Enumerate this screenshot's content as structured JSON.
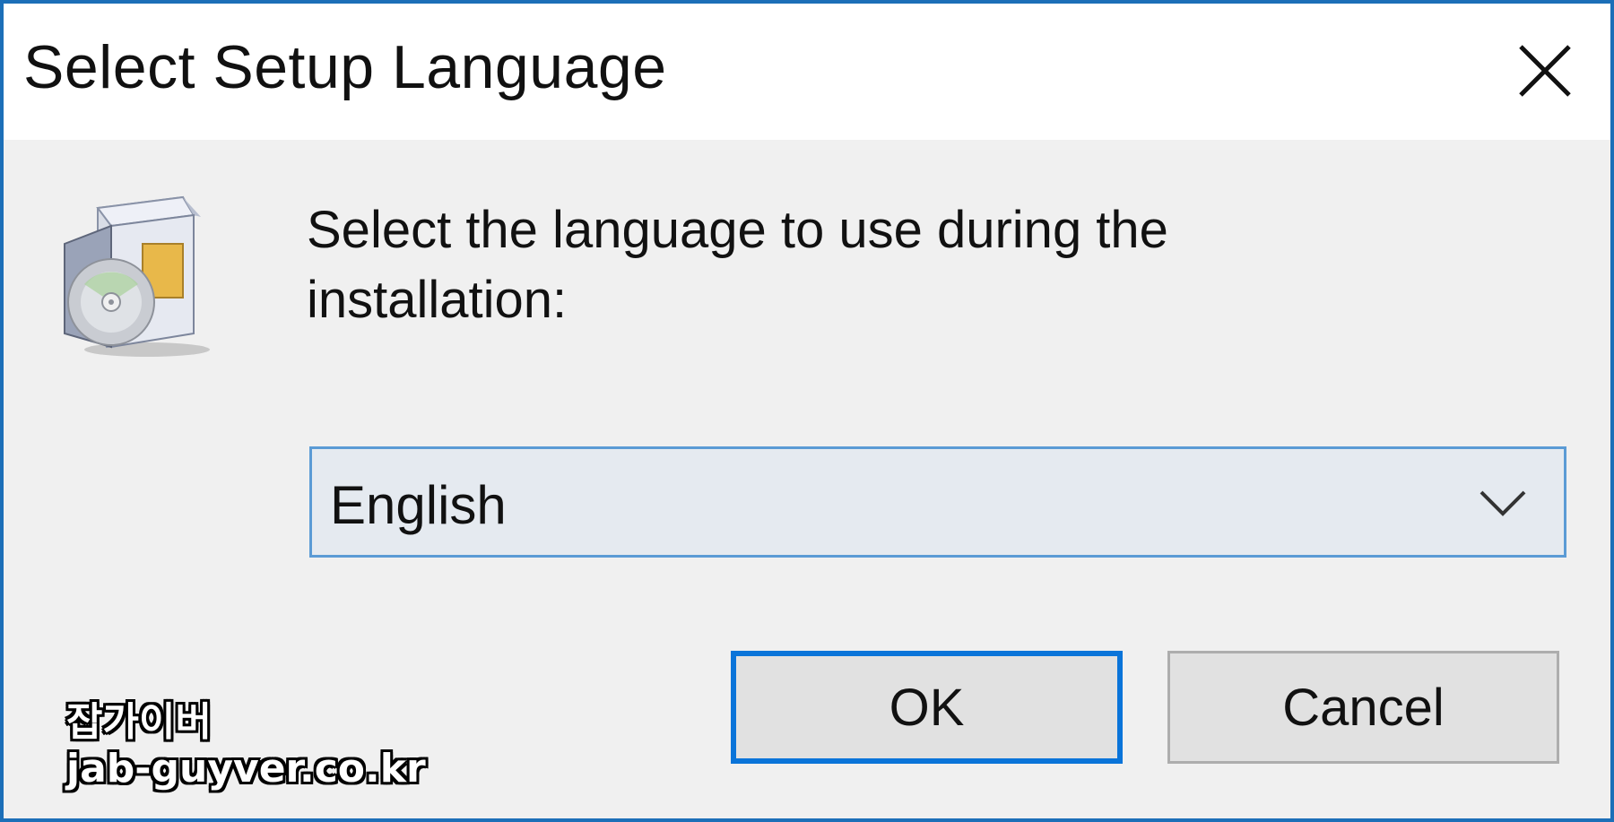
{
  "window": {
    "title": "Select Setup Language",
    "accent_color": "#1c6fb8"
  },
  "titlebar": {
    "close_icon": "close-icon"
  },
  "content": {
    "icon": "setup-package-icon",
    "prompt": "Select the language to use during the installation:"
  },
  "language_select": {
    "selected": "English",
    "arrow_icon": "chevron-down-icon"
  },
  "buttons": {
    "ok_label": "OK",
    "cancel_label": "Cancel"
  },
  "watermark": {
    "line1": "잡가이버",
    "line2": "jab-guyver.co.kr"
  }
}
